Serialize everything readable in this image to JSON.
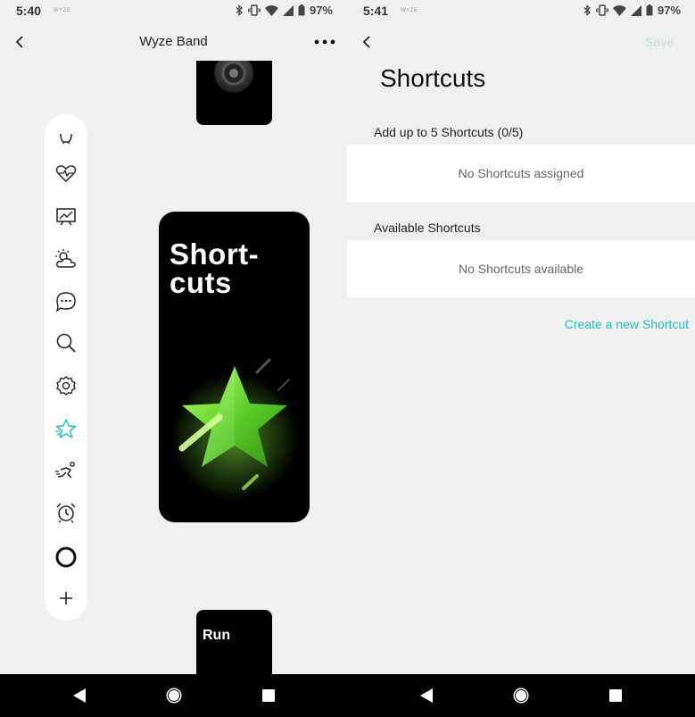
{
  "left": {
    "status": {
      "time": "5:40",
      "carrier": "WYZE",
      "battery": "97%"
    },
    "title": "Wyze Band",
    "sidebar": {
      "items": [
        {
          "icon": "steps-icon"
        },
        {
          "icon": "heart-rate-icon"
        },
        {
          "icon": "activity-chart-icon"
        },
        {
          "icon": "weather-icon"
        },
        {
          "icon": "messages-icon"
        },
        {
          "icon": "search-icon"
        },
        {
          "icon": "settings-icon"
        },
        {
          "icon": "star-icon",
          "active": true
        },
        {
          "icon": "run-icon"
        },
        {
          "icon": "alarm-icon"
        },
        {
          "icon": "alexa-icon"
        },
        {
          "icon": "add-icon"
        }
      ],
      "active_color": "#2bbfb0"
    },
    "cards": {
      "main_title": "Short-\ncuts",
      "bottom_label": "Run"
    }
  },
  "right": {
    "status": {
      "time": "5:41",
      "carrier": "WYZE",
      "battery": "97%"
    },
    "save_label": "Save",
    "page_title": "Shortcuts",
    "assigned": {
      "label": "Add up to 5 Shortcuts (0/5)",
      "empty": "No Shortcuts assigned"
    },
    "available": {
      "label": "Available Shortcuts",
      "empty": "No Shortcuts available"
    },
    "create_link": "Create a new Shortcut",
    "accent_color": "#2bbfb0"
  }
}
